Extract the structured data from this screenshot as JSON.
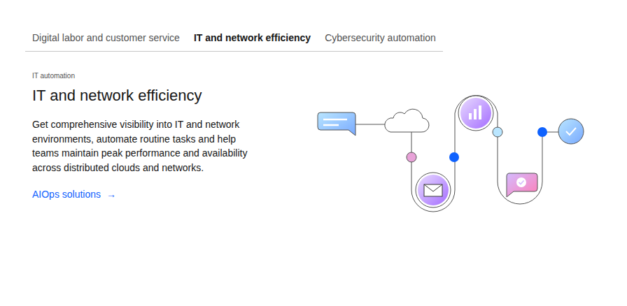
{
  "tabs": [
    {
      "label": "Digital labor and customer service",
      "selected": false
    },
    {
      "label": "IT and network efficiency",
      "selected": true
    },
    {
      "label": "Cybersecurity automation",
      "selected": false
    }
  ],
  "panel": {
    "eyebrow": "IT automation",
    "heading": "IT and network efficiency",
    "description": "Get comprehensive visibility into IT and network environments, automate routine tasks and help teams maintain peak performance and availability across distributed clouds and networks.",
    "link": {
      "label": "AIOps solutions",
      "arrow": "→"
    }
  }
}
